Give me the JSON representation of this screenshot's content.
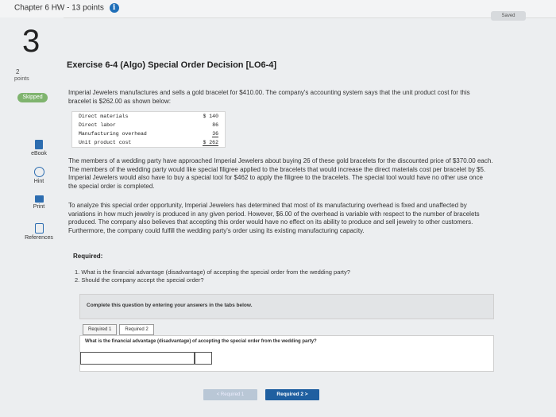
{
  "header": {
    "chapter_title": "Chapter 6 HW - 13 points",
    "saved": "Saved"
  },
  "question": {
    "number": "3",
    "points_value": "2",
    "points_label": "points",
    "status": "Skipped"
  },
  "tools": {
    "ebook": "eBook",
    "hint": "Hint",
    "print": "Print",
    "references": "References"
  },
  "exercise": {
    "title": "Exercise 6-4 (Algo) Special Order Decision [LO6-4]",
    "intro": "Imperial Jewelers manufactures and sells a gold bracelet for $410.00. The company's accounting system says that the unit product cost for this bracelet is $262.00 as shown below:",
    "cost_rows": [
      {
        "label": "Direct materials",
        "amount": "$ 140"
      },
      {
        "label": "Direct labor",
        "amount": "86"
      },
      {
        "label": "Manufacturing overhead",
        "amount": "36"
      },
      {
        "label": "Unit product cost",
        "amount": "$ 262"
      }
    ],
    "para2": "The members of a wedding party have approached Imperial Jewelers about buying 26 of these gold bracelets for the discounted price of $370.00 each. The members of the wedding party would like special filigree applied to the bracelets that would increase the direct materials cost per bracelet by $5. Imperial Jewelers would also have to buy a special tool for $462 to apply the filigree to the bracelets. The special tool would have no other use once the special order is completed.",
    "para3": "To analyze this special order opportunity, Imperial Jewelers has determined that most of its manufacturing overhead is fixed and unaffected by variations in how much jewelry is produced in any given period. However, $6.00 of the overhead is variable with respect to the number of bracelets produced. The company also believes that accepting this order would have no effect on its ability to produce and sell jewelry to other customers. Furthermore, the company could fulfill the wedding party's order using its existing manufacturing capacity.",
    "required_heading": "Required:",
    "required_items": [
      "1. What is the financial advantage (disadvantage) of accepting the special order from the wedding party?",
      "2. Should the company accept the special order?"
    ]
  },
  "answer": {
    "instruction": "Complete this question by entering your answers in the tabs below.",
    "tabs": [
      "Required 1",
      "Required 2"
    ],
    "tab_question": "What is the financial advantage (disadvantage) of accepting the special order from the wedding party?",
    "prev_label": "< Required 1",
    "next_label": "Required 2 >"
  }
}
